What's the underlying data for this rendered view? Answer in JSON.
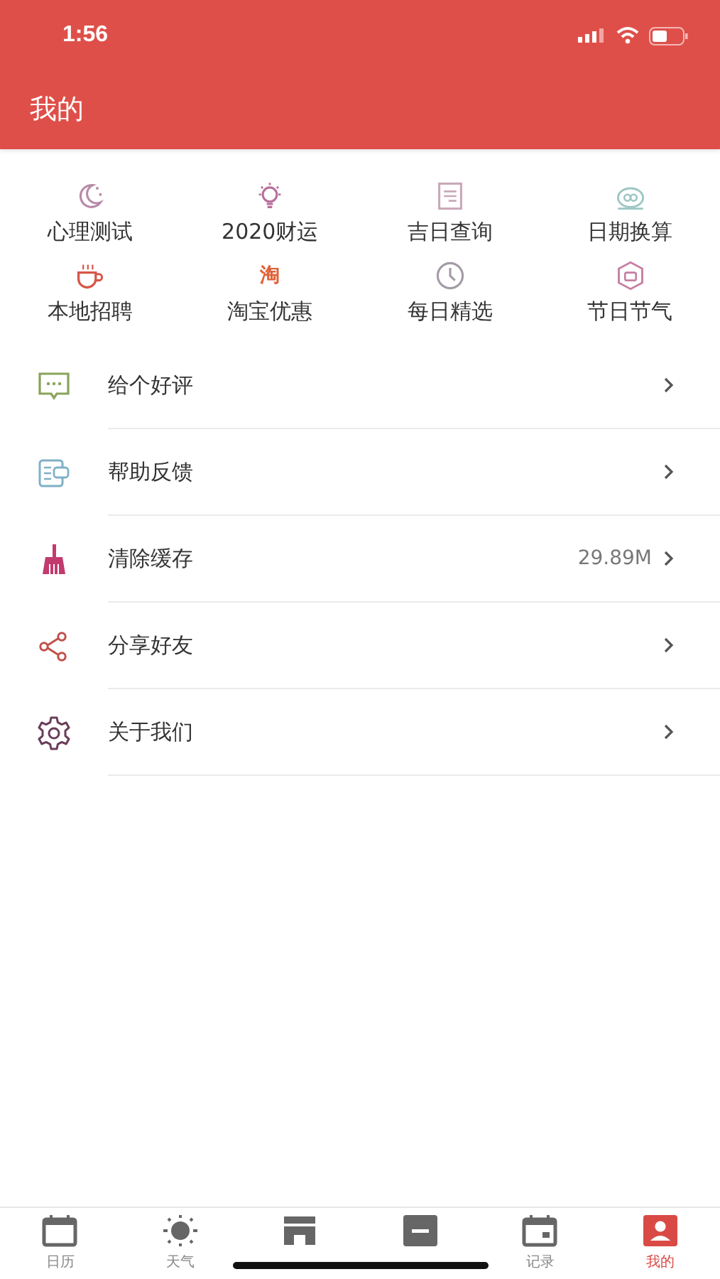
{
  "status_bar": {
    "time": "1:56"
  },
  "header": {
    "title": "我的"
  },
  "shortcuts": [
    {
      "label": "心理测试"
    },
    {
      "label": "2020财运"
    },
    {
      "label": "吉日查询"
    },
    {
      "label": "日期换算"
    },
    {
      "label": "本地招聘"
    },
    {
      "label": "淘宝优惠",
      "icon_text": "淘"
    },
    {
      "label": "每日精选"
    },
    {
      "label": "节日节气"
    }
  ],
  "menu": [
    {
      "label": "给个好评"
    },
    {
      "label": "帮助反馈"
    },
    {
      "label": "清除缓存",
      "value": "29.89M"
    },
    {
      "label": "分享好友"
    },
    {
      "label": "关于我们"
    }
  ],
  "tab_bar": [
    {
      "label": "日历",
      "selected": false
    },
    {
      "label": "天气",
      "selected": false
    },
    {
      "selected": false
    },
    {
      "selected": false
    },
    {
      "label": "记录",
      "selected": false
    },
    {
      "label": "我的",
      "selected": true
    }
  ]
}
